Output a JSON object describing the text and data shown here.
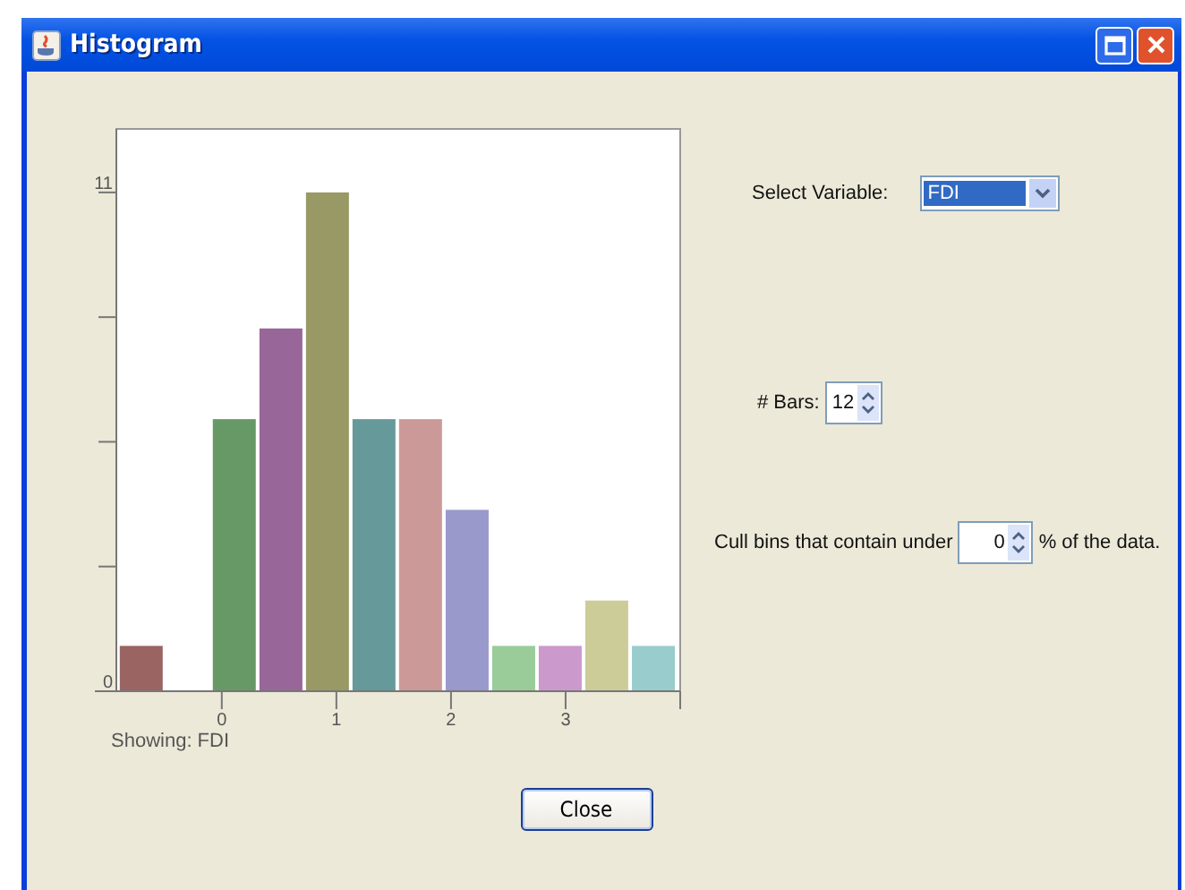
{
  "window": {
    "title": "Histogram"
  },
  "chart": {
    "chart_data": {
      "type": "bar",
      "x": [
        -0.703,
        -0.297,
        0.109,
        0.516,
        0.922,
        1.328,
        1.734,
        2.141,
        2.547,
        2.953,
        3.359,
        3.766
      ],
      "values": [
        1,
        0,
        6,
        8,
        11,
        6,
        6,
        4,
        1,
        1,
        2,
        1
      ],
      "xlim": [
        -0.92,
        4.0
      ],
      "ylim": [
        0,
        12.4
      ],
      "xticks": [
        0,
        1,
        2,
        3
      ],
      "yticks": [
        0,
        11
      ]
    },
    "caption": "Showing: FDI"
  },
  "controls": {
    "variable_label": "Select Variable:",
    "variable_value": "FDI",
    "bars_label": "# Bars:",
    "bars_value": "12",
    "cull_label": "Cull bins that contain under",
    "cull_value": "0",
    "cull_suffix": "% of the data."
  },
  "buttons": [
    "Close"
  ]
}
